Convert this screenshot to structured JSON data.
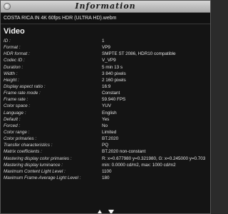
{
  "window": {
    "title": "Information"
  },
  "file": {
    "name": "COSTA RICA IN 4K 60fps HDR (ULTRA HD).webm"
  },
  "section": {
    "heading": "Video"
  },
  "rows": [
    {
      "key": "ID :",
      "value": "1"
    },
    {
      "key": "Format :",
      "value": "VP9"
    },
    {
      "key": "HDR format :",
      "value": "SMPTE ST 2086, HDR10 compatible"
    },
    {
      "key": "Codec ID :",
      "value": "V_VP9"
    },
    {
      "key": "Duration :",
      "value": "5 min 13 s"
    },
    {
      "key": "Width :",
      "value": "3 840 pixels"
    },
    {
      "key": "Height :",
      "value": "2 160 pixels"
    },
    {
      "key": "Display aspect ratio :",
      "value": "16:9"
    },
    {
      "key": "Frame rate mode :",
      "value": "Constant"
    },
    {
      "key": "Frame rate :",
      "value": "59.940 FPS"
    },
    {
      "key": "Color space :",
      "value": "YUV"
    },
    {
      "key": "Language :",
      "value": "English"
    },
    {
      "key": "Default :",
      "value": "Yes"
    },
    {
      "key": "Forced :",
      "value": "No"
    },
    {
      "key": "Color range :",
      "value": "Limited"
    },
    {
      "key": "Color primaries :",
      "value": "BT.2020"
    },
    {
      "key": "Transfer characteristics :",
      "value": "PQ"
    },
    {
      "key": "Matrix coefficients :",
      "value": "BT.2020 non-constant"
    },
    {
      "key": "Mastering display color primaries :",
      "value": "R: x=0.677980 y=0.321980, G: x=0.245000 y=0.703"
    },
    {
      "key": "Mastering display luminance :",
      "value": "min: 0.0000 cd/m2, max: 1000 cd/m2"
    },
    {
      "key": "Maximum Content Light Level :",
      "value": "1100"
    },
    {
      "key": "Maximum Frame-Average Light Level :",
      "value": "180"
    }
  ],
  "icons": {
    "close": "close-icon",
    "scroll_up": "scroll-up-arrow-icon",
    "scroll_down": "scroll-down-arrow-icon"
  }
}
